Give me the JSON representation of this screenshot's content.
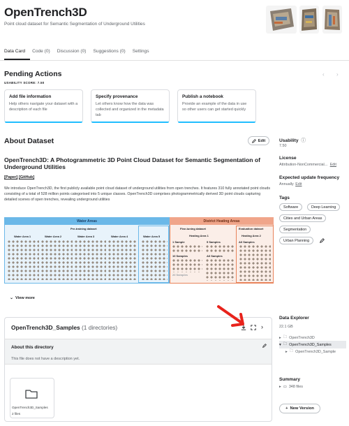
{
  "header": {
    "title": "OpenTrench3D",
    "subtitle": "Point cloud dataset for Semantic Segmentation of Underground Utilities"
  },
  "tabs": [
    {
      "label": "Data Card",
      "active": true
    },
    {
      "label": "Code (0)"
    },
    {
      "label": "Discussion (0)"
    },
    {
      "label": "Suggestions (0)"
    },
    {
      "label": "Settings"
    }
  ],
  "pending": {
    "title": "Pending Actions",
    "usability": "USABILITY SCORE: 7.50",
    "cards": [
      {
        "title": "Add file information",
        "desc": "Help others navigate your dataset with a description of each file"
      },
      {
        "title": "Specify provenance",
        "desc": "Let others know how the data was collected and organized in the metadata tab"
      },
      {
        "title": "Publish a notebook",
        "desc": "Provide an example of the data in use so other users can get started quickly"
      }
    ]
  },
  "about": {
    "heading": "About Dataset",
    "edit_label": "Edit",
    "paper_title": "OpenTrench3D: A Photogrammetric 3D Point Cloud Dataset for Semantic Segmentation of Underground Utilities",
    "link_paper": "[Paper]",
    "link_github": "[GitHub]",
    "description": "We introduce OpenTrench3D, the first publicly available point cloud dataset of underground utilities from open trenches. It features 310 fully annotated point clouds consisting of a total of 528 million points categorised into 5 unique classes. OpenTrench3D comprises photogrammetrically derived 3D point clouds capturing detailed scenes of open trenches, revealing underground utilities",
    "view_more": "View more"
  },
  "figure": {
    "water_areas": "Water Areas",
    "district_heating": "District Heating Areas",
    "pretraining": "Pre-training dataset",
    "water_area_labels": [
      "Water Area 1",
      "Water Area 2",
      "Water Area 3",
      "Water Area 4",
      "Water Area 5"
    ],
    "finetuning": "Fine-tuning dataset",
    "evaluation": "Evaluation dataset",
    "heating_area_1": "Heating Area 1",
    "heating_area_2": "Heating Area 2",
    "sample_labels": [
      "1 Sample",
      "5 Samples",
      "10 Samples",
      "All Samples",
      "All Samples",
      "20 Samples"
    ]
  },
  "samples": {
    "name": "OpenTrench3D_Samples",
    "count": "(1 directories)",
    "about_title": "About this directory",
    "about_desc": "This file does not have a description yet.",
    "folder_name": "OpenTrench3D_Samples",
    "folder_files": "2 files"
  },
  "sidebar": {
    "usability_label": "Usability",
    "usability_value": "7.50",
    "license_label": "License",
    "license_value": "Attribution-NonCommercial...",
    "license_edit": "Edit",
    "update_label": "Expected update frequency",
    "update_value": "Annually",
    "update_edit": "Edit",
    "tags_label": "Tags",
    "tags": [
      "Software",
      "Deep Learning",
      "Cities and Urban Areas",
      "Segmentation",
      "Urban Planning"
    ],
    "explorer_label": "Data Explorer",
    "explorer_size": "22.1 GB",
    "tree": [
      "OpenTrench3D",
      "OpenTrench3D_Samples",
      "OpenTrench3D_Sample"
    ],
    "summary_label": "Summary",
    "summary_files": "348 files",
    "new_version": "New Version"
  },
  "colors": {
    "accent": "#20beff",
    "water_header": "#6bb8e8",
    "heating_header": "#f0a58a",
    "water_bg": "#e8f3fb",
    "heating_bg": "#fbeee8",
    "arrow": "#e8231c"
  }
}
